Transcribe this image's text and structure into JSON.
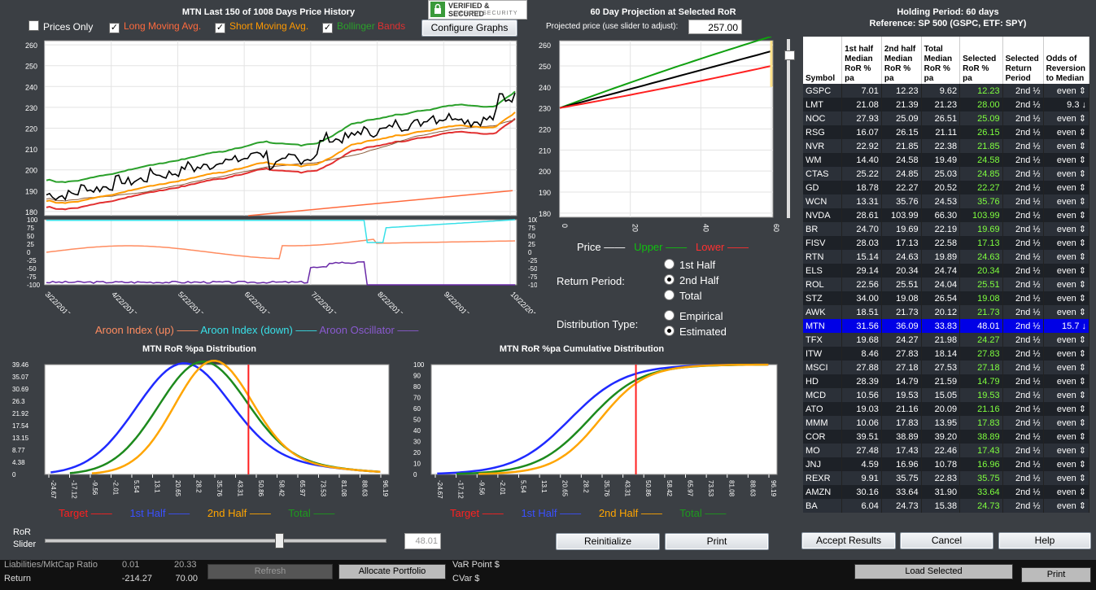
{
  "top_left": {
    "title": "MTN Last 150 of 1008 Days Price History",
    "prices_only": "Prices Only",
    "long_ma": "Long Moving Avg.",
    "short_ma": "Short Moving Avg.",
    "bollinger": "Bollinger",
    "bands": "Bands",
    "configure": "Configure Graphs",
    "price_ticks": [
      "260",
      "250",
      "240",
      "230",
      "220",
      "210",
      "200",
      "190",
      "180"
    ],
    "aroon_ticks": [
      "100",
      "75",
      "50",
      "25",
      "0",
      "-25",
      "-50",
      "-75",
      "-100"
    ],
    "date_ticks": [
      "3/22/2017",
      "4/22/2017",
      "5/22/2017",
      "6/22/2017",
      "7/22/2017",
      "8/22/2017",
      "9/22/2017",
      "10/22/2017"
    ],
    "aroon_up": "Aroon Index (up)",
    "aroon_down": "Aroon Index (down)",
    "aroon_osc": "Aroon Oscillator"
  },
  "badge": {
    "line1": "VERIFIED & SECURED",
    "line2": "VERIFY SECURITY"
  },
  "projection": {
    "title": "60 Day Projection at Selected RoR",
    "price_label": "Projected price (use slider to adjust):",
    "price_value": "257.00",
    "y_ticks": [
      "260",
      "250",
      "240",
      "230",
      "220",
      "210",
      "200",
      "190",
      "180"
    ],
    "x_ticks": [
      "0",
      "20",
      "40",
      "60"
    ],
    "legend_price": "Price",
    "legend_upper": "Upper",
    "legend_lower": "Lower",
    "return_period_label": "Return Period:",
    "rp_options": [
      "1st Half",
      "2nd Half",
      "Total"
    ],
    "dist_label": "Distribution Type:",
    "dist_options": [
      "Empirical",
      "Estimated"
    ]
  },
  "header_right": {
    "line1": "Holding Period: 60 days",
    "line2": "Reference: SP 500 (GSPC, ETF: SPY)"
  },
  "table": {
    "headers": [
      "Symbol",
      "1st half Median RoR % pa",
      "2nd half Median RoR % pa",
      "Total Median RoR % pa",
      "Selected RoR % pa",
      "Selected Return Period",
      "Odds of Reversion to Median"
    ],
    "rows": [
      [
        "GSPC",
        "7.01",
        "12.23",
        "9.62",
        "12.23",
        "2nd ½",
        "even ⇕"
      ],
      [
        "LMT",
        "21.08",
        "21.39",
        "21.23",
        "28.00",
        "2nd ½",
        "9.3 ↓"
      ],
      [
        "NOC",
        "27.93",
        "25.09",
        "26.51",
        "25.09",
        "2nd ½",
        "even ⇕"
      ],
      [
        "RSG",
        "16.07",
        "26.15",
        "21.11",
        "26.15",
        "2nd ½",
        "even ⇕"
      ],
      [
        "NVR",
        "22.92",
        "21.85",
        "22.38",
        "21.85",
        "2nd ½",
        "even ⇕"
      ],
      [
        "WM",
        "14.40",
        "24.58",
        "19.49",
        "24.58",
        "2nd ½",
        "even ⇕"
      ],
      [
        "CTAS",
        "25.22",
        "24.85",
        "25.03",
        "24.85",
        "2nd ½",
        "even ⇕"
      ],
      [
        "GD",
        "18.78",
        "22.27",
        "20.52",
        "22.27",
        "2nd ½",
        "even ⇕"
      ],
      [
        "WCN",
        "13.31",
        "35.76",
        "24.53",
        "35.76",
        "2nd ½",
        "even ⇕"
      ],
      [
        "NVDA",
        "28.61",
        "103.99",
        "66.30",
        "103.99",
        "2nd ½",
        "even ⇕"
      ],
      [
        "BR",
        "24.70",
        "19.69",
        "22.19",
        "19.69",
        "2nd ½",
        "even ⇕"
      ],
      [
        "FISV",
        "28.03",
        "17.13",
        "22.58",
        "17.13",
        "2nd ½",
        "even ⇕"
      ],
      [
        "RTN",
        "15.14",
        "24.63",
        "19.89",
        "24.63",
        "2nd ½",
        "even ⇕"
      ],
      [
        "ELS",
        "29.14",
        "20.34",
        "24.74",
        "20.34",
        "2nd ½",
        "even ⇕"
      ],
      [
        "ROL",
        "22.56",
        "25.51",
        "24.04",
        "25.51",
        "2nd ½",
        "even ⇕"
      ],
      [
        "STZ",
        "34.00",
        "19.08",
        "26.54",
        "19.08",
        "2nd ½",
        "even ⇕"
      ],
      [
        "AWK",
        "18.51",
        "21.73",
        "20.12",
        "21.73",
        "2nd ½",
        "even ⇕"
      ],
      [
        "MTN",
        "31.56",
        "36.09",
        "33.83",
        "48.01",
        "2nd ½",
        "15.7 ↓"
      ],
      [
        "TFX",
        "19.68",
        "24.27",
        "21.98",
        "24.27",
        "2nd ½",
        "even ⇕"
      ],
      [
        "ITW",
        "8.46",
        "27.83",
        "18.14",
        "27.83",
        "2nd ½",
        "even ⇕"
      ],
      [
        "MSCI",
        "27.88",
        "27.18",
        "27.53",
        "27.18",
        "2nd ½",
        "even ⇕"
      ],
      [
        "HD",
        "28.39",
        "14.79",
        "21.59",
        "14.79",
        "2nd ½",
        "even ⇕"
      ],
      [
        "MCD",
        "10.56",
        "19.53",
        "15.05",
        "19.53",
        "2nd ½",
        "even ⇕"
      ],
      [
        "ATO",
        "19.03",
        "21.16",
        "20.09",
        "21.16",
        "2nd ½",
        "even ⇕"
      ],
      [
        "MMM",
        "10.06",
        "17.83",
        "13.95",
        "17.83",
        "2nd ½",
        "even ⇕"
      ],
      [
        "COR",
        "39.51",
        "38.89",
        "39.20",
        "38.89",
        "2nd ½",
        "even ⇕"
      ],
      [
        "MO",
        "27.48",
        "17.43",
        "22.46",
        "17.43",
        "2nd ½",
        "even ⇕"
      ],
      [
        "JNJ",
        "4.59",
        "16.96",
        "10.78",
        "16.96",
        "2nd ½",
        "even ⇕"
      ],
      [
        "REXR",
        "9.91",
        "35.75",
        "22.83",
        "35.75",
        "2nd ½",
        "even ⇕"
      ],
      [
        "AMZN",
        "30.16",
        "33.64",
        "31.90",
        "33.64",
        "2nd ½",
        "even ⇕"
      ],
      [
        "BA",
        "6.04",
        "24.73",
        "15.38",
        "24.73",
        "2nd ½",
        "even ⇕"
      ]
    ],
    "highlight_symbol": "MTN"
  },
  "dist": {
    "title": "MTN RoR %pa Distribution",
    "y_ticks": [
      "39.46",
      "35.07",
      "30.69",
      "26.3",
      "21.92",
      "17.54",
      "13.15",
      "8.77",
      "4.38",
      "0"
    ],
    "x_ticks": [
      "-24.67",
      "-17.12",
      "-9.56",
      "-2.01",
      "5.54",
      "13.1",
      "20.65",
      "28.2",
      "35.76",
      "43.31",
      "50.86",
      "58.42",
      "65.97",
      "73.53",
      "81.08",
      "88.63",
      "96.19"
    ],
    "legend": [
      "Target",
      "1st Half",
      "2nd Half",
      "Total"
    ]
  },
  "cum": {
    "title": "MTN RoR %pa Cumulative Distribution",
    "y_ticks": [
      "100",
      "90",
      "80",
      "70",
      "60",
      "50",
      "40",
      "30",
      "20",
      "10",
      "0"
    ],
    "x_ticks": [
      "-24.67",
      "-17.12",
      "-9.56",
      "-2.01",
      "5.54",
      "13.1",
      "20.65",
      "28.2",
      "35.76",
      "43.31",
      "50.86",
      "58.42",
      "65.97",
      "73.53",
      "81.08",
      "88.63",
      "96.19"
    ],
    "legend": [
      "Target",
      "1st Half",
      "2nd Half",
      "Total"
    ]
  },
  "controls": {
    "ror_label1": "RoR",
    "ror_label2": "Slider",
    "ror_value": "48.01",
    "slider_fraction": 0.69,
    "reinitialize": "Reinitialize",
    "print": "Print",
    "accept": "Accept Results",
    "cancel": "Cancel",
    "help": "Help"
  },
  "bottom_bar": {
    "ratio_label": "Liabilities/MktCap Ratio",
    "ratio_v1": "0.01",
    "ratio_v2": "20.33",
    "return_label": "Return",
    "return_v1": "-214.27",
    "return_v2": "70.00",
    "refresh": "Refresh",
    "allocate": "Allocate Portfolio",
    "var_label": "VaR Point $",
    "cvar_label": "CVar $",
    "load_selected": "Load Selected",
    "print": "Print"
  },
  "colors": {
    "long_ma": "#ff6a3d",
    "short_ma": "#ff9900",
    "bollinger": "#2aa02a",
    "bands": "#e23030",
    "aroon_up": "#ff8c60",
    "aroon_down": "#38e0e8",
    "aroon_osc": "#6a2aa8",
    "upper": "#10a010",
    "lower": "#ff2020",
    "first": "#1f2aff",
    "second": "#ffa500",
    "total": "#1d8a1d"
  }
}
